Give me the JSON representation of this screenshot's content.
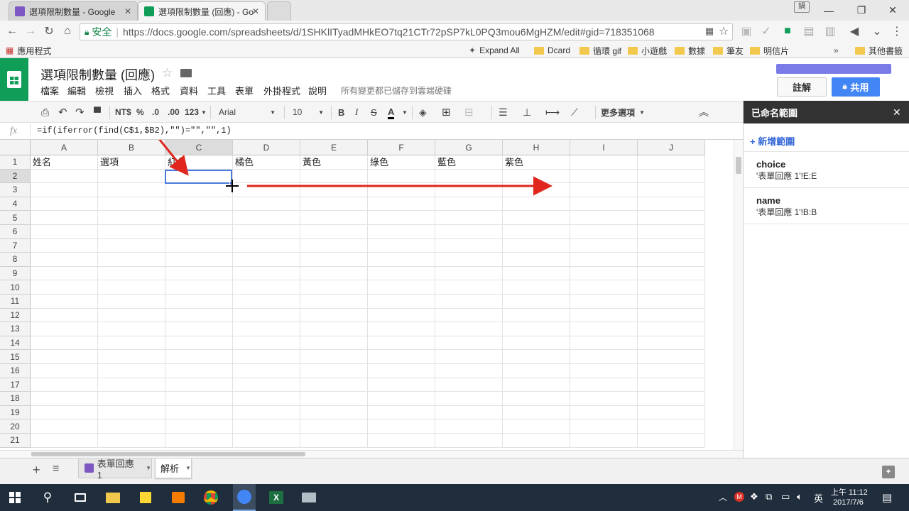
{
  "browser": {
    "tabs": [
      {
        "title": "選項限制數量 - Google",
        "active": false
      },
      {
        "title": "選項限制數量 (回應) - Go",
        "active": true
      }
    ],
    "security_label": "安全",
    "url": "https://docs.google.com/spreadsheets/d/1SHKlITyadMHkEO7tq21CTr72pSP7kL0PQ3mou6MgHZM/edit#gid=718351068",
    "bookmarks": [
      {
        "label": "應用程式",
        "icon": "apps-icon"
      },
      {
        "label": "Expand All",
        "icon": "star-icon"
      },
      {
        "label": "Dcard",
        "icon": "folder-icon"
      },
      {
        "label": "循環 gif",
        "icon": "folder-icon"
      },
      {
        "label": "小遊戲",
        "icon": "folder-icon"
      },
      {
        "label": "數據",
        "icon": "folder-icon"
      },
      {
        "label": "筆友",
        "icon": "folder-icon"
      },
      {
        "label": "明信片",
        "icon": "folder-icon"
      },
      {
        "label": "其他書籤",
        "icon": "folder-icon"
      }
    ],
    "overflow_label": "»"
  },
  "sheets": {
    "title": "選項限制數量 (回應)",
    "menus": [
      "檔案",
      "編輯",
      "檢視",
      "插入",
      "格式",
      "資料",
      "工具",
      "表單",
      "外掛程式",
      "說明"
    ],
    "save_status": "所有變更都已儲存到雲端硬碟",
    "comments_label": "註解",
    "share_label": "共用",
    "toolbar": {
      "currency": "NT$",
      "percent": "%",
      "decrease_decimal": ".0",
      "increase_decimal": ".00",
      "number_format": "123",
      "font": "Arial",
      "font_size": "10",
      "bold": "B",
      "italic": "I",
      "strike": "S",
      "text_color": "A",
      "more": "更多選項"
    },
    "formula_label": "fx",
    "formula": "=if(iferror(find(C$1,$B2),\"\")=\"\",\"\",1)",
    "columns": [
      "A",
      "B",
      "C",
      "D",
      "E",
      "F",
      "G",
      "H",
      "I",
      "J"
    ],
    "rows": [
      "1",
      "2",
      "3",
      "4",
      "5",
      "6",
      "7",
      "8",
      "9",
      "10",
      "11",
      "12",
      "13",
      "14",
      "15",
      "16",
      "17",
      "18",
      "19",
      "20",
      "21"
    ],
    "header_row": [
      "姓名",
      "選項",
      "紅色",
      "橘色",
      "黃色",
      "綠色",
      "藍色",
      "紫色",
      "",
      ""
    ],
    "selected_cell": "C2",
    "sheet_tabs": [
      {
        "label": "表單回應 1",
        "active": false
      },
      {
        "label": "解析",
        "active": true
      }
    ]
  },
  "panel": {
    "title": "已命名範圍",
    "add_label": "+ 新增範圍",
    "ranges": [
      {
        "name": "choice",
        "ref": "'表單回應 1'!E:E"
      },
      {
        "name": "name",
        "ref": "'表單回應 1'!B:B"
      }
    ]
  },
  "taskbar": {
    "time": "上午 11:12",
    "date": "2017/7/6",
    "ime": "英"
  },
  "colors": {
    "sheets_green": "#0f9d58",
    "share_blue": "#4285f4",
    "selection_blue": "#4a7bdc",
    "arrow_red": "#e0261d"
  }
}
